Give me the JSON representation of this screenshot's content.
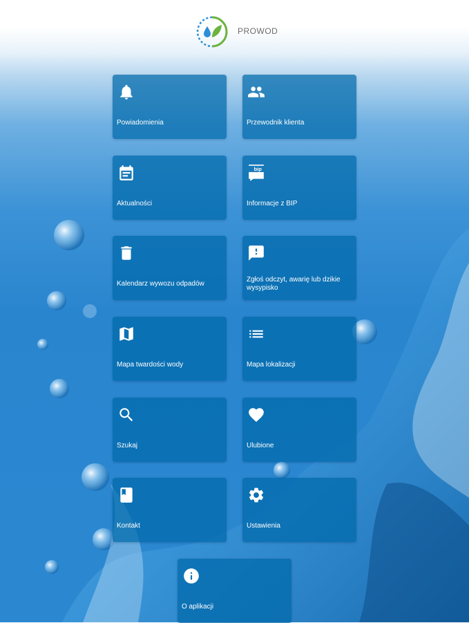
{
  "app": {
    "name": "PROWOD"
  },
  "menu": {
    "notifications": "Powiadomienia",
    "customer_guide": "Przewodnik klienta",
    "news": "Aktualności",
    "bip": "Informacje z BIP",
    "waste_calendar": "Kalendarz wywozu odpadów",
    "report": "Zgłoś odczyt, awarię lub dzikie wysypisko",
    "hardness_map": "Mapa twardości wody",
    "location_map": "Mapa lokalizacji",
    "search": "Szukaj",
    "favorites": "Ulubione",
    "contact": "Kontakt",
    "settings": "Ustawienia",
    "about": "O aplikacji"
  },
  "icons": {
    "bip_badge": "bip"
  },
  "colors": {
    "tile": "#0069aa",
    "logo_blue": "#2b8fd6",
    "logo_green": "#6cb33f"
  }
}
